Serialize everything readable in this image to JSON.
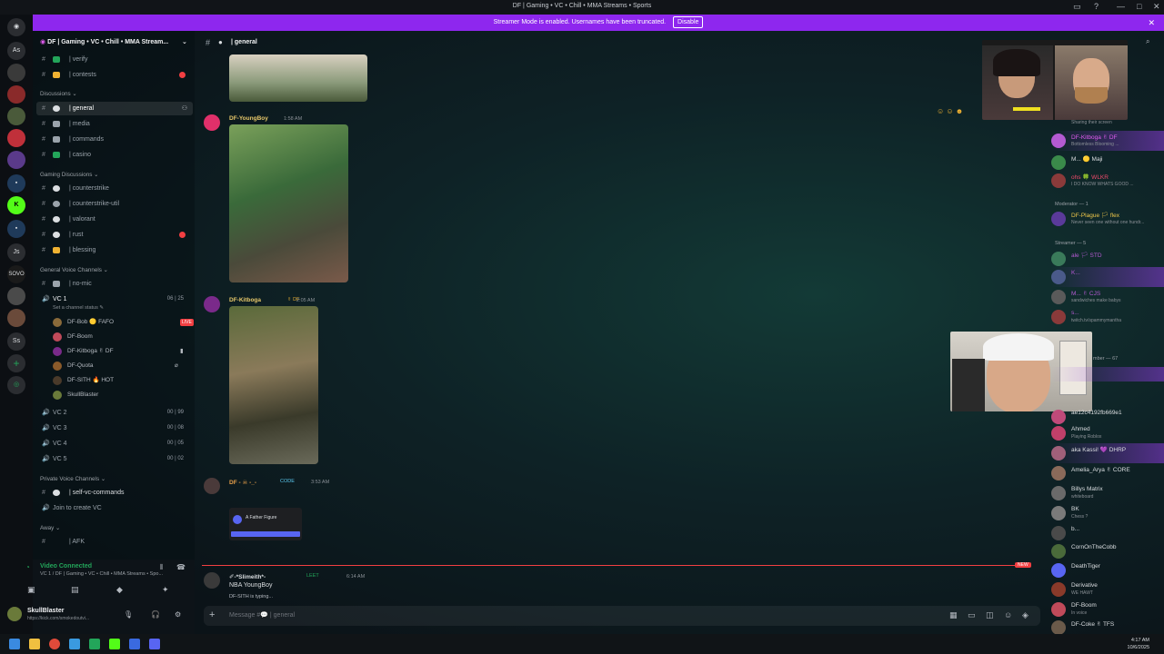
{
  "window": {
    "title": "DF | Gaming • VC • Chill • MMA Streams • Sports"
  },
  "streamer_banner": {
    "text": "Streamer Mode is enabled. Usernames have been truncated.",
    "button": "Disable"
  },
  "server_list": [
    "As",
    "Js",
    "SOVO",
    "Ss"
  ],
  "sidebar": {
    "server_name": "DF | Gaming • VC • Chill • MMA Stream...",
    "top_channels": [
      {
        "label": "| verify",
        "color": "#23a55a"
      },
      {
        "label": "| contests",
        "color": "#f0b232"
      }
    ],
    "cat_discussions": "Discussions ⌄",
    "discussion_channels": [
      {
        "label": "| general",
        "color": "#dbdee1"
      },
      {
        "label": "| media",
        "color": "#dbdee1"
      },
      {
        "label": "| commands",
        "color": "#dbdee1"
      },
      {
        "label": "| casino",
        "color": "#23a55a"
      }
    ],
    "cat_gaming": "Gaming Discussions ⌄",
    "gaming_channels": [
      {
        "label": "| counterstrike",
        "color": "#dbdee1"
      },
      {
        "label": "| counterstrike-util",
        "color": "#dbdee1"
      },
      {
        "label": "| valorant",
        "color": "#dbdee1"
      },
      {
        "label": "| rust",
        "color": "#dbdee1"
      },
      {
        "label": "| blessing",
        "color": "#f0b232"
      }
    ],
    "cat_voice": "General Voice Channels ⌄",
    "no_mic": "| no-mic",
    "vc1": {
      "name": "VC 1",
      "status": "Set a channel status ✎",
      "count": "06 | 25"
    },
    "vc1_users": [
      {
        "name": "DF-Bob 🟡 FAFO",
        "color": "#8a6a3a",
        "live": "LIVE"
      },
      {
        "name": "DF-Boom",
        "color": "#c04a5a",
        "live": ""
      },
      {
        "name": "DF-Kitboga ✌ DF",
        "color": "#7a2a8a",
        "live": ""
      },
      {
        "name": "DF-Quota",
        "color": "#8a5a2a",
        "live": ""
      },
      {
        "name": "DF-SITH 🔥 HOT",
        "color": "#4a3a2a",
        "live": ""
      },
      {
        "name": "SkullBlaster",
        "color": "#6a7a3a",
        "live": ""
      }
    ],
    "voice_channels": [
      {
        "label": "VC 2",
        "count": "00 | 99"
      },
      {
        "label": "VC 3",
        "count": "00 | 08"
      },
      {
        "label": "VC 4",
        "count": "00 | 05"
      },
      {
        "label": "VC 5",
        "count": "00 | 02"
      }
    ],
    "cat_private": "Private Voice Channels ⌄",
    "self_vc": "| self-vc-commands",
    "join_vc": "Join to create VC",
    "cat_away": "Away ⌄",
    "afk": "| AFK"
  },
  "user_panel": {
    "connected": "Video Connected",
    "connected_sub": "VC 1 / DF | Gaming • VC • Chill • MMA Streams • Spo...",
    "username": "SkullBlaster",
    "user_status": "https://kick.com/smokedoutvi..."
  },
  "chat": {
    "channel_label": "| general",
    "messages": [
      {
        "author": "DF-YoungBoy",
        "time": "1:58 AM",
        "color": "#e8c86a"
      },
      {
        "author": "DF-Kitboga",
        "tag": "✌ DF",
        "time": "2:05 AM",
        "color": "#e8c86a"
      },
      {
        "author": "DF - ☠ -_-",
        "tag": "CODE",
        "time": "3:53 AM",
        "color": "#e8a04a"
      },
      {
        "author": "✐-*Slimeith*-",
        "tag": "LEET",
        "time": "6:14 AM",
        "color": "#dbdee1",
        "text": "NBA YoungBoy"
      }
    ],
    "embed_title": "A Father Figure",
    "new_badge": "NEW",
    "typing": "DF-SITH is typing...",
    "placeholder": "Message #💬 | general"
  },
  "members": {
    "top_status": "Sharing their screen",
    "list": [
      {
        "name": "DF-Kitboga ✌ DF",
        "status": "Bottomless Blooming ...",
        "color": "#b45ad2",
        "nameColor": "#e15cf0",
        "hl": true
      },
      {
        "name": "M... 🟡 Maji",
        "status": "",
        "color": "#3a8a4a",
        "nameColor": "#dbdee1",
        "hl": false
      },
      {
        "name": "ohs 🍀 WLKR",
        "status": "I DO KNOW WHATS GOOD ...",
        "color": "#8a3a3a",
        "nameColor": "#f04a6a",
        "hl": false
      },
      {
        "name": "DF-Plague 🏳 flex",
        "status": "Never seen one without one hundr...",
        "color": "#5a3a9a",
        "nameColor": "#f0c84a",
        "hl": false
      },
      {
        "name": "ale 🏳 STD",
        "status": "",
        "color": "#3a7a5a",
        "nameColor": "#b45ad2",
        "hl": false
      },
      {
        "name": "K...",
        "status": "",
        "color": "#4a5a8a",
        "nameColor": "#b45ad2",
        "hl": true
      },
      {
        "name": "M... ✌ CJS",
        "status": "sandwiches make babys",
        "color": "#5a5a5a",
        "nameColor": "#b45ad2",
        "hl": false
      },
      {
        "name": "s...",
        "status": "twitch.tv/spammymantha",
        "color": "#8a3a3a",
        "nameColor": "#b45ad2",
        "hl": false
      },
      {
        "name": "ae12c4192fb669e1",
        "status": "",
        "color": "#c04a7a",
        "nameColor": "#dbdee1",
        "hl": false
      },
      {
        "name": "Ahmed",
        "status": "Playing Roblox",
        "color": "#c0406a",
        "nameColor": "#dbdee1",
        "hl": false
      },
      {
        "name": "aka Kassi! 💜 DHRP",
        "status": "",
        "color": "#a0607a",
        "nameColor": "#dbdee1",
        "hl": true
      },
      {
        "name": "Amelia_Arya ✌ CORE",
        "status": "",
        "color": "#8a6a5a",
        "nameColor": "#dbdee1",
        "hl": false
      },
      {
        "name": "Billys Matrix",
        "status": "whiteboard",
        "color": "#6a6a6a",
        "nameColor": "#dbdee1",
        "hl": false
      },
      {
        "name": "BK",
        "status": "Chess ?",
        "color": "#7a7a7a",
        "nameColor": "#dbdee1",
        "hl": false
      },
      {
        "name": "b...",
        "status": "",
        "color": "#4a4a4a",
        "nameColor": "#dbdee1",
        "hl": false
      },
      {
        "name": "CornOnTheCobb",
        "status": "",
        "color": "#4a6a3a",
        "nameColor": "#dbdee1",
        "hl": false
      },
      {
        "name": "DeathTiger",
        "status": "",
        "color": "#5865f2",
        "nameColor": "#dbdee1",
        "hl": false
      },
      {
        "name": "Derivative",
        "status": "WE HAWT",
        "color": "#8a3a2a",
        "nameColor": "#dbdee1",
        "hl": false
      },
      {
        "name": "DF-Boom",
        "status": "In voice",
        "color": "#c04a5a",
        "nameColor": "#dbdee1",
        "hl": false
      },
      {
        "name": "DF-Coke ✌ TFS",
        "status": "",
        "color": "#6a5a4a",
        "nameColor": "#dbdee1",
        "hl": false
      }
    ],
    "cat_moderator": "Moderator — 1",
    "cat_streamer": "Streamer — 5",
    "cat_member": "mber — 67"
  },
  "system_tray": {
    "time": "4:17 AM",
    "date": "10/6/2025"
  }
}
